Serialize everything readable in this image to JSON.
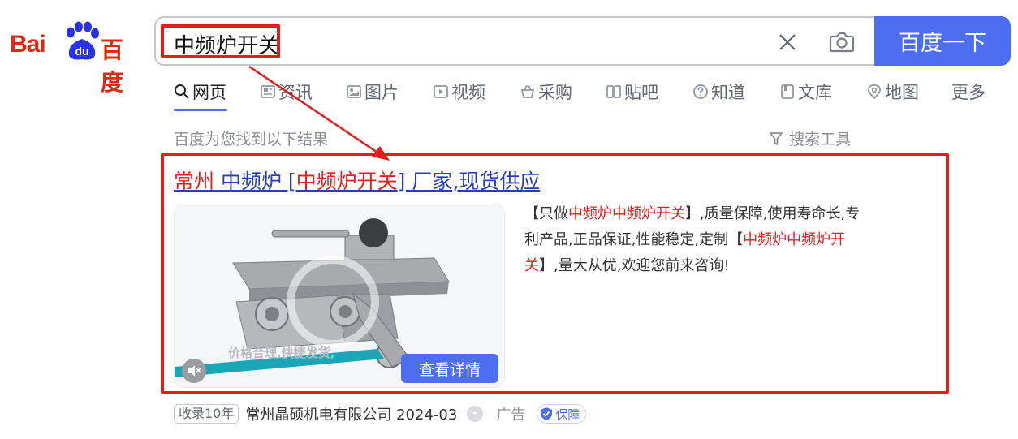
{
  "logo": {
    "text_latin": "Bai",
    "text_paw": "du",
    "text_cn": "百度"
  },
  "search": {
    "query": "中频炉开关",
    "button_label": "百度一下"
  },
  "tabs": [
    {
      "label": "网页",
      "icon": "search-icon"
    },
    {
      "label": "资讯",
      "icon": "news-icon"
    },
    {
      "label": "图片",
      "icon": "image-icon"
    },
    {
      "label": "视频",
      "icon": "video-icon"
    },
    {
      "label": "采购",
      "icon": "basket-icon"
    },
    {
      "label": "贴吧",
      "icon": "tieba-icon"
    },
    {
      "label": "知道",
      "icon": "question-icon"
    },
    {
      "label": "文库",
      "icon": "document-icon"
    },
    {
      "label": "地图",
      "icon": "map-pin-icon"
    },
    {
      "label": "更多",
      "icon": ""
    }
  ],
  "results": {
    "count_text": "百度为您找到以下结果",
    "tools_label": "搜索工具"
  },
  "ad": {
    "title_part1": "常州 ",
    "title_part2": "中频炉 [",
    "title_part3": "中频炉开关",
    "title_part4": "] 厂家,现货供应",
    "image_caption": "价格合理,快捷发货,",
    "details_button": "查看详情",
    "desc_1": "【只做",
    "desc_2": "中频炉中频炉开关",
    "desc_3": "】,质量保障,使用寿命长,专利产品,正品保证,性能稳定,定制【",
    "desc_4": "中频炉中频炉开关",
    "desc_5": "】,量大从优,欢迎您前来咨询!",
    "badge_years": "收录10年",
    "company": "常州晶硕机电有限公司 2024-03",
    "ad_label": "广告",
    "guarantee": "保障"
  },
  "colors": {
    "accent": "#4e6ef2",
    "highlight": "#e02020",
    "link": "#2440b3",
    "brand_red": "#de2910"
  }
}
